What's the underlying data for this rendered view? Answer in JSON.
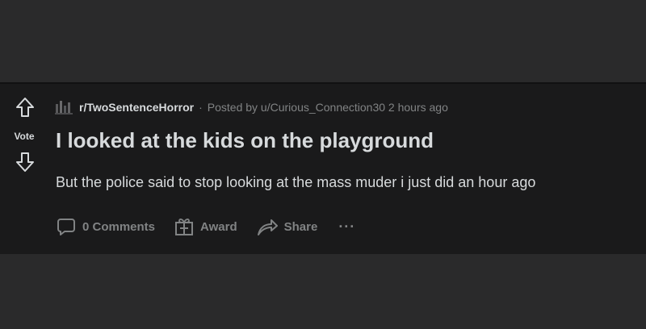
{
  "post": {
    "vote_label": "Vote",
    "subreddit": "r/TwoSentenceHorror",
    "meta_separator": "·",
    "posted_by": "Posted by u/Curious_Connection30 2 hours ago",
    "title": "I looked at the kids on the playground",
    "body": "But the police said to stop looking at the mass muder i just did an hour ago"
  },
  "actions": {
    "comments_label": "0 Comments",
    "award_label": "Award",
    "share_label": "Share",
    "more_label": "···"
  },
  "icons": {
    "upvote": "upvote-arrow-icon",
    "downvote": "downvote-arrow-icon",
    "subreddit": "subreddit-avatar-icon",
    "comments": "comment-bubble-icon",
    "award": "gift-icon",
    "share": "share-arrow-icon"
  },
  "colors": {
    "page_background": "#2a2a2b",
    "post_background": "#1a1a1b",
    "primary_text": "#d7dadc",
    "secondary_text": "#818384"
  }
}
